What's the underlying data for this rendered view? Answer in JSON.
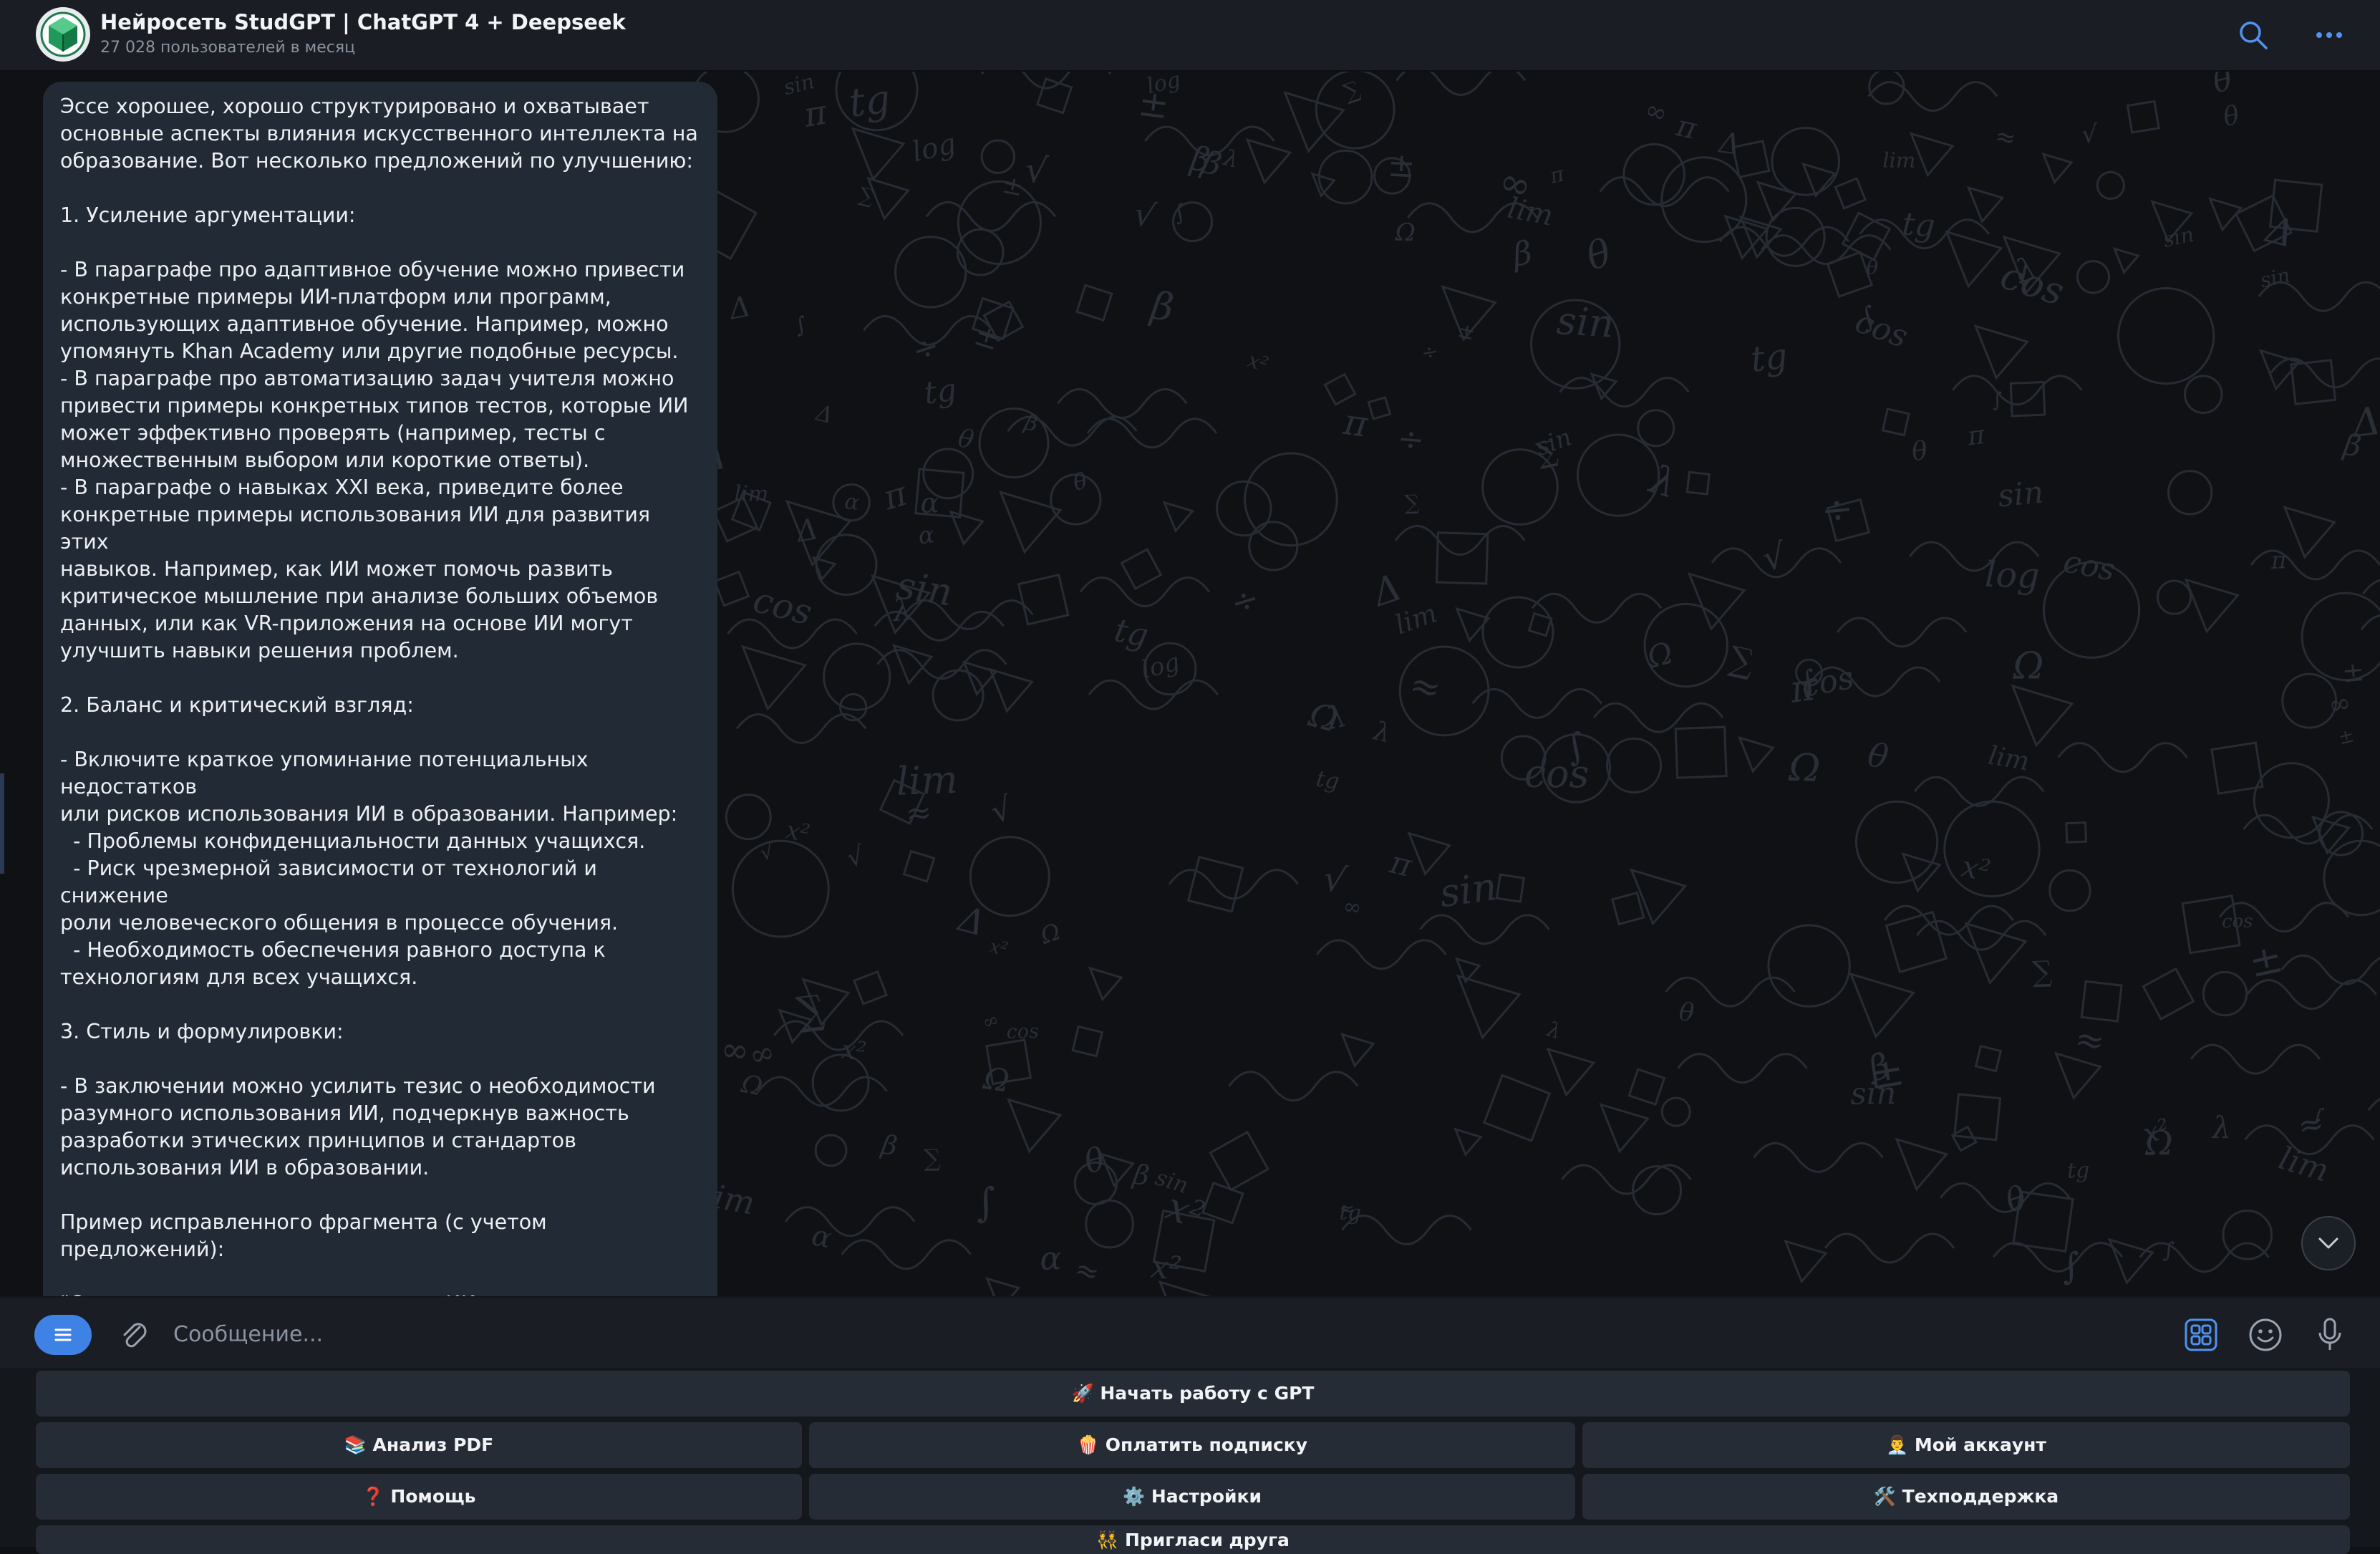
{
  "header": {
    "title": "Нейросеть StudGPT | ChatGPT 4 + Deepseek",
    "subtitle": "27 028 пользователей в месяц",
    "search_icon": "search-icon",
    "more_icon": "more-icon"
  },
  "message": {
    "text": "Эссе хорошее, хорошо структурировано и охватывает\nосновные аспекты влияния искусственного интеллекта на\nобразование. Вот несколько предложений по улучшению:\n\n1. Усиление аргументации:\n\n- В параграфе про адаптивное обучение можно привести\nконкретные примеры ИИ-платформ или программ,\nиспользующих адаптивное обучение. Например, можно\nупомянуть Khan Academy или другие подобные ресурсы.\n- В параграфе про автоматизацию задач учителя можно\nпривести примеры конкретных типов тестов, которые ИИ\nможет эффективно проверять (например, тесты с\nмножественным выбором или короткие ответы).\n- В параграфе о навыках XXI века, приведите более\nконкретные примеры использования ИИ для развития этих\nнавыков. Например, как ИИ может помочь развить\nкритическое мышление при анализе больших объемов\nданных, или как VR-приложения на основе ИИ могут\nулучшить навыки решения проблем.\n\n2. Баланс и критический взгляд:\n\n- Включите краткое упоминание потенциальных недостатков\nили рисков использования ИИ в образовании. Например:\n  - Проблемы конфиденциальности данных учащихся.\n  - Риск чрезмерной зависимости от технологий и снижение\nроли человеческого общения в процессе обучения.\n  - Необходимость обеспечения равного доступа к\nтехнологиям для всех учащихся.\n\n3. Стиль и формулировки:\n\n- В заключении можно усилить тезис о необходимости\nразумного использования ИИ, подчеркнув важность\nразработки этических принципов и стандартов\nиспользования ИИ в образовании.\n\nПример исправленного фрагмента (с учетом предложений):\n\n\"Одним из ключевых преимуществ ИИ является адаптивное\nобучение. Системы, основанные на ИИ, такие как платформа\nX или система Y, анализируют прогресс учащегося и\nподбирают материалы с учётом его сильных и слабых\nсторон. Это..."
  },
  "composer": {
    "placeholder": "Сообщение...",
    "menu_icon": "menu-icon",
    "attach_icon": "paperclip-icon",
    "commands_icon": "bot-commands-icon",
    "emoji_icon": "emoji-icon",
    "mic_icon": "microphone-icon"
  },
  "keyboard": {
    "start": "🚀 Начать работу с GPT",
    "pdf": "📚 Анализ PDF",
    "pay": "🍿 Оплатить подписку",
    "account": "👨‍💼 Мой аккаунт",
    "help": "❓ Помощь",
    "settings": "⚙️ Настройки",
    "support": "🛠️ Техподдержка",
    "invite": "👯 Пригласи друга"
  },
  "colors": {
    "accent": "#3f82e6",
    "bubble": "#222a35",
    "header": "#1a1e24",
    "keyboard_button": "#262c35"
  }
}
